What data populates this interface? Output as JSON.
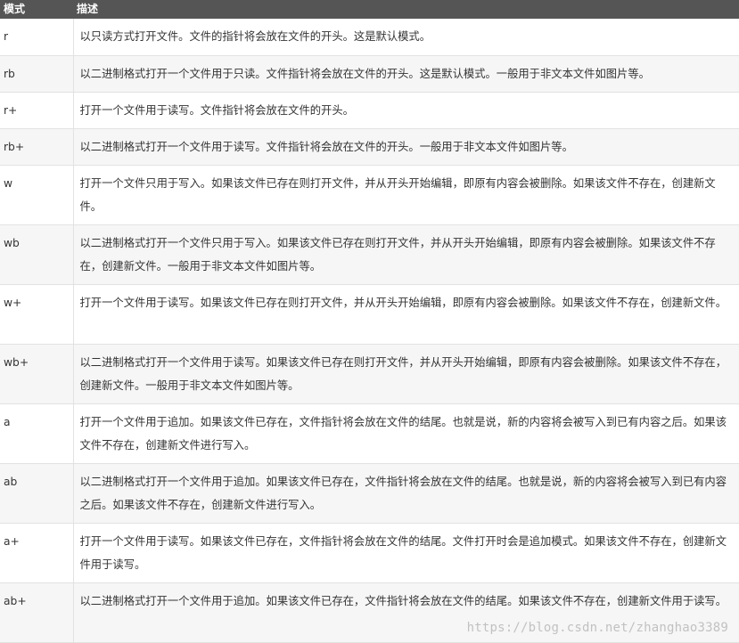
{
  "header": {
    "mode": "模式",
    "description": "描述"
  },
  "rows": [
    {
      "mode": "r",
      "desc": "以只读方式打开文件。文件的指针将会放在文件的开头。这是默认模式。"
    },
    {
      "mode": "rb",
      "desc": "以二进制格式打开一个文件用于只读。文件指针将会放在文件的开头。这是默认模式。一般用于非文本文件如图片等。"
    },
    {
      "mode": "r+",
      "desc": "打开一个文件用于读写。文件指针将会放在文件的开头。"
    },
    {
      "mode": "rb+",
      "desc": "以二进制格式打开一个文件用于读写。文件指针将会放在文件的开头。一般用于非文本文件如图片等。"
    },
    {
      "mode": "w",
      "desc": "打开一个文件只用于写入。如果该文件已存在则打开文件，并从开头开始编辑，即原有内容会被删除。如果该文件不存在，创建新文件。"
    },
    {
      "mode": "wb",
      "desc": "以二进制格式打开一个文件只用于写入。如果该文件已存在则打开文件，并从开头开始编辑，即原有内容会被删除。如果该文件不存在，创建新文件。一般用于非文本文件如图片等。"
    },
    {
      "mode": "w+",
      "desc": "打开一个文件用于读写。如果该文件已存在则打开文件，并从开头开始编辑，即原有内容会被删除。如果该文件不存在，创建新文件。"
    },
    {
      "mode": "wb+",
      "desc": "以二进制格式打开一个文件用于读写。如果该文件已存在则打开文件，并从开头开始编辑，即原有内容会被删除。如果该文件不存在，创建新文件。一般用于非文本文件如图片等。"
    },
    {
      "mode": "a",
      "desc": "打开一个文件用于追加。如果该文件已存在，文件指针将会放在文件的结尾。也就是说，新的内容将会被写入到已有内容之后。如果该文件不存在，创建新文件进行写入。"
    },
    {
      "mode": "ab",
      "desc": "以二进制格式打开一个文件用于追加。如果该文件已存在，文件指针将会放在文件的结尾。也就是说，新的内容将会被写入到已有内容之后。如果该文件不存在，创建新文件进行写入。"
    },
    {
      "mode": "a+",
      "desc": "打开一个文件用于读写。如果该文件已存在，文件指针将会放在文件的结尾。文件打开时会是追加模式。如果该文件不存在，创建新文件用于读写。"
    },
    {
      "mode": "ab+",
      "desc": "以二进制格式打开一个文件用于追加。如果该文件已存在，文件指针将会放在文件的结尾。如果该文件不存在，创建新文件用于读写。"
    }
  ],
  "watermark": "https://blog.csdn.net/zhanghao3389"
}
